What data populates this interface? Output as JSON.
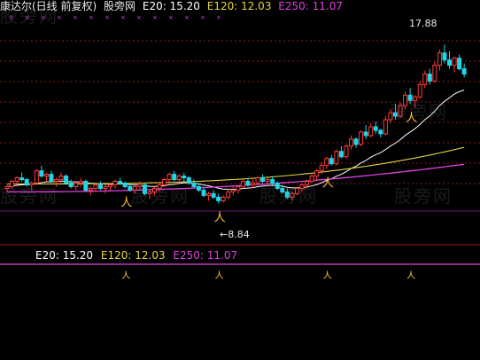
{
  "header": {
    "title": "康达尔(日线 前复权)",
    "site": "股旁网",
    "e20_label": "E20: 15.20",
    "e120_label": "E120: 12.03",
    "e250_label": "E250: 11.07"
  },
  "sub_header": {
    "e20_label": "E20: 15.20",
    "e120_label": "E120: 12.03",
    "e250_label": "E250: 11.07"
  },
  "watermark": "股旁网",
  "colors": {
    "up": "#ff3b3b",
    "down": "#1fd7e6",
    "e20": "#ffffff",
    "e120": "#e6d43c",
    "e250": "#e040e0",
    "grid": "#8b1a1a",
    "marker": "#ffc83c"
  },
  "chart_data": {
    "type": "candlestick",
    "title": "康达尔(日线 前复权)",
    "ylim": [
      6.8,
      19.5
    ],
    "annotations": [
      {
        "label": "17.88",
        "value": 17.88,
        "kind": "high"
      },
      {
        "label": "8.84",
        "value": 8.84,
        "kind": "low"
      }
    ],
    "series": [
      {
        "name": "E20",
        "last": 15.2
      },
      {
        "name": "E120",
        "last": 12.03
      },
      {
        "name": "E250",
        "last": 11.07
      }
    ],
    "candles": [
      [
        9.7,
        9.9,
        9.5,
        9.8
      ],
      [
        9.8,
        10.2,
        9.7,
        10.1
      ],
      [
        10.1,
        10.4,
        9.9,
        10.3
      ],
      [
        10.3,
        10.6,
        10.1,
        10.2
      ],
      [
        10.2,
        10.3,
        9.8,
        9.9
      ],
      [
        9.9,
        10.1,
        9.6,
        10.0
      ],
      [
        10.0,
        10.8,
        9.9,
        10.7
      ],
      [
        10.7,
        11.0,
        10.3,
        10.4
      ],
      [
        10.4,
        10.6,
        10.1,
        10.5
      ],
      [
        10.5,
        10.7,
        10.0,
        10.1
      ],
      [
        10.1,
        10.3,
        9.8,
        10.2
      ],
      [
        10.2,
        10.6,
        10.0,
        10.4
      ],
      [
        10.4,
        10.5,
        9.9,
        10.0
      ],
      [
        10.0,
        10.2,
        9.7,
        9.8
      ],
      [
        9.8,
        10.1,
        9.6,
        10.0
      ],
      [
        10.0,
        10.3,
        9.8,
        10.1
      ],
      [
        10.1,
        10.2,
        9.5,
        9.6
      ],
      [
        9.6,
        9.8,
        9.3,
        9.7
      ],
      [
        9.7,
        10.0,
        9.5,
        9.9
      ],
      [
        9.9,
        10.1,
        9.6,
        9.7
      ],
      [
        9.7,
        9.9,
        9.4,
        9.8
      ],
      [
        9.8,
        10.0,
        9.6,
        9.9
      ],
      [
        9.9,
        10.2,
        9.7,
        10.1
      ],
      [
        10.1,
        10.3,
        9.9,
        10.0
      ],
      [
        10.0,
        10.1,
        9.7,
        9.8
      ],
      [
        9.8,
        10.0,
        9.5,
        9.6
      ],
      [
        9.6,
        9.9,
        9.4,
        9.8
      ],
      [
        9.8,
        10.1,
        9.6,
        9.9
      ],
      [
        9.9,
        10.0,
        9.3,
        9.4
      ],
      [
        9.4,
        9.6,
        9.1,
        9.5
      ],
      [
        9.5,
        9.8,
        9.3,
        9.7
      ],
      [
        9.7,
        10.0,
        9.5,
        9.9
      ],
      [
        9.9,
        10.3,
        9.8,
        10.2
      ],
      [
        10.2,
        10.6,
        10.0,
        10.5
      ],
      [
        10.5,
        10.7,
        10.1,
        10.2
      ],
      [
        10.2,
        10.5,
        10.0,
        10.4
      ],
      [
        10.4,
        10.6,
        10.1,
        10.3
      ],
      [
        10.3,
        10.4,
        9.9,
        10.0
      ],
      [
        10.0,
        10.2,
        9.7,
        9.8
      ],
      [
        9.8,
        10.0,
        9.5,
        9.6
      ],
      [
        9.6,
        9.8,
        9.2,
        9.3
      ],
      [
        9.3,
        9.5,
        9.0,
        9.4
      ],
      [
        9.4,
        9.6,
        9.1,
        9.2
      ],
      [
        9.2,
        9.4,
        8.84,
        9.0
      ],
      [
        9.0,
        9.3,
        8.9,
        9.2
      ],
      [
        9.2,
        9.6,
        9.1,
        9.5
      ],
      [
        9.5,
        9.8,
        9.3,
        9.6
      ],
      [
        9.6,
        9.9,
        9.4,
        9.8
      ],
      [
        9.8,
        10.2,
        9.7,
        10.1
      ],
      [
        10.1,
        10.3,
        9.8,
        9.9
      ],
      [
        9.9,
        10.2,
        9.7,
        10.0
      ],
      [
        10.0,
        10.4,
        9.9,
        10.3
      ],
      [
        10.3,
        10.5,
        10.0,
        10.1
      ],
      [
        10.1,
        10.3,
        9.8,
        10.2
      ],
      [
        10.2,
        10.4,
        9.9,
        10.0
      ],
      [
        10.0,
        10.1,
        9.6,
        9.7
      ],
      [
        9.7,
        9.9,
        9.4,
        9.5
      ],
      [
        9.5,
        9.7,
        9.1,
        9.2
      ],
      [
        9.2,
        9.5,
        9.0,
        9.4
      ],
      [
        9.4,
        9.8,
        9.3,
        9.7
      ],
      [
        9.7,
        10.0,
        9.5,
        9.9
      ],
      [
        9.9,
        10.2,
        9.7,
        10.1
      ],
      [
        10.1,
        10.5,
        10.0,
        10.4
      ],
      [
        10.4,
        10.8,
        10.2,
        10.7
      ],
      [
        10.7,
        11.2,
        10.5,
        11.0
      ],
      [
        11.0,
        11.5,
        10.8,
        11.4
      ],
      [
        11.4,
        11.6,
        11.0,
        11.1
      ],
      [
        11.1,
        11.9,
        11.0,
        11.8
      ],
      [
        11.8,
        12.1,
        11.4,
        11.5
      ],
      [
        11.5,
        12.2,
        11.4,
        12.1
      ],
      [
        12.1,
        12.7,
        11.9,
        12.5
      ],
      [
        12.5,
        12.6,
        12.0,
        12.2
      ],
      [
        12.2,
        13.0,
        12.1,
        12.9
      ],
      [
        12.9,
        13.3,
        12.5,
        12.7
      ],
      [
        12.7,
        13.4,
        12.6,
        13.2
      ],
      [
        13.2,
        13.5,
        12.8,
        13.0
      ],
      [
        13.0,
        13.1,
        12.6,
        12.8
      ],
      [
        12.8,
        13.8,
        12.7,
        13.6
      ],
      [
        13.6,
        14.2,
        13.4,
        14.0
      ],
      [
        14.0,
        14.5,
        13.6,
        13.8
      ],
      [
        13.8,
        14.6,
        13.7,
        14.4
      ],
      [
        14.4,
        15.2,
        14.2,
        15.0
      ],
      [
        15.0,
        15.4,
        14.5,
        14.7
      ],
      [
        14.7,
        15.0,
        14.3,
        14.9
      ],
      [
        14.9,
        15.8,
        14.8,
        15.6
      ],
      [
        15.6,
        16.4,
        15.4,
        16.2
      ],
      [
        16.2,
        16.5,
        15.6,
        15.8
      ],
      [
        15.8,
        16.9,
        15.7,
        16.7
      ],
      [
        16.7,
        17.6,
        16.4,
        17.4
      ],
      [
        17.4,
        17.88,
        16.8,
        17.0
      ],
      [
        17.0,
        17.5,
        16.5,
        16.7
      ],
      [
        16.7,
        17.2,
        16.3,
        17.1
      ],
      [
        17.1,
        17.3,
        16.4,
        16.5
      ],
      [
        16.5,
        16.8,
        16.0,
        16.2
      ]
    ],
    "markers": [
      24,
      43,
      65,
      82
    ]
  }
}
